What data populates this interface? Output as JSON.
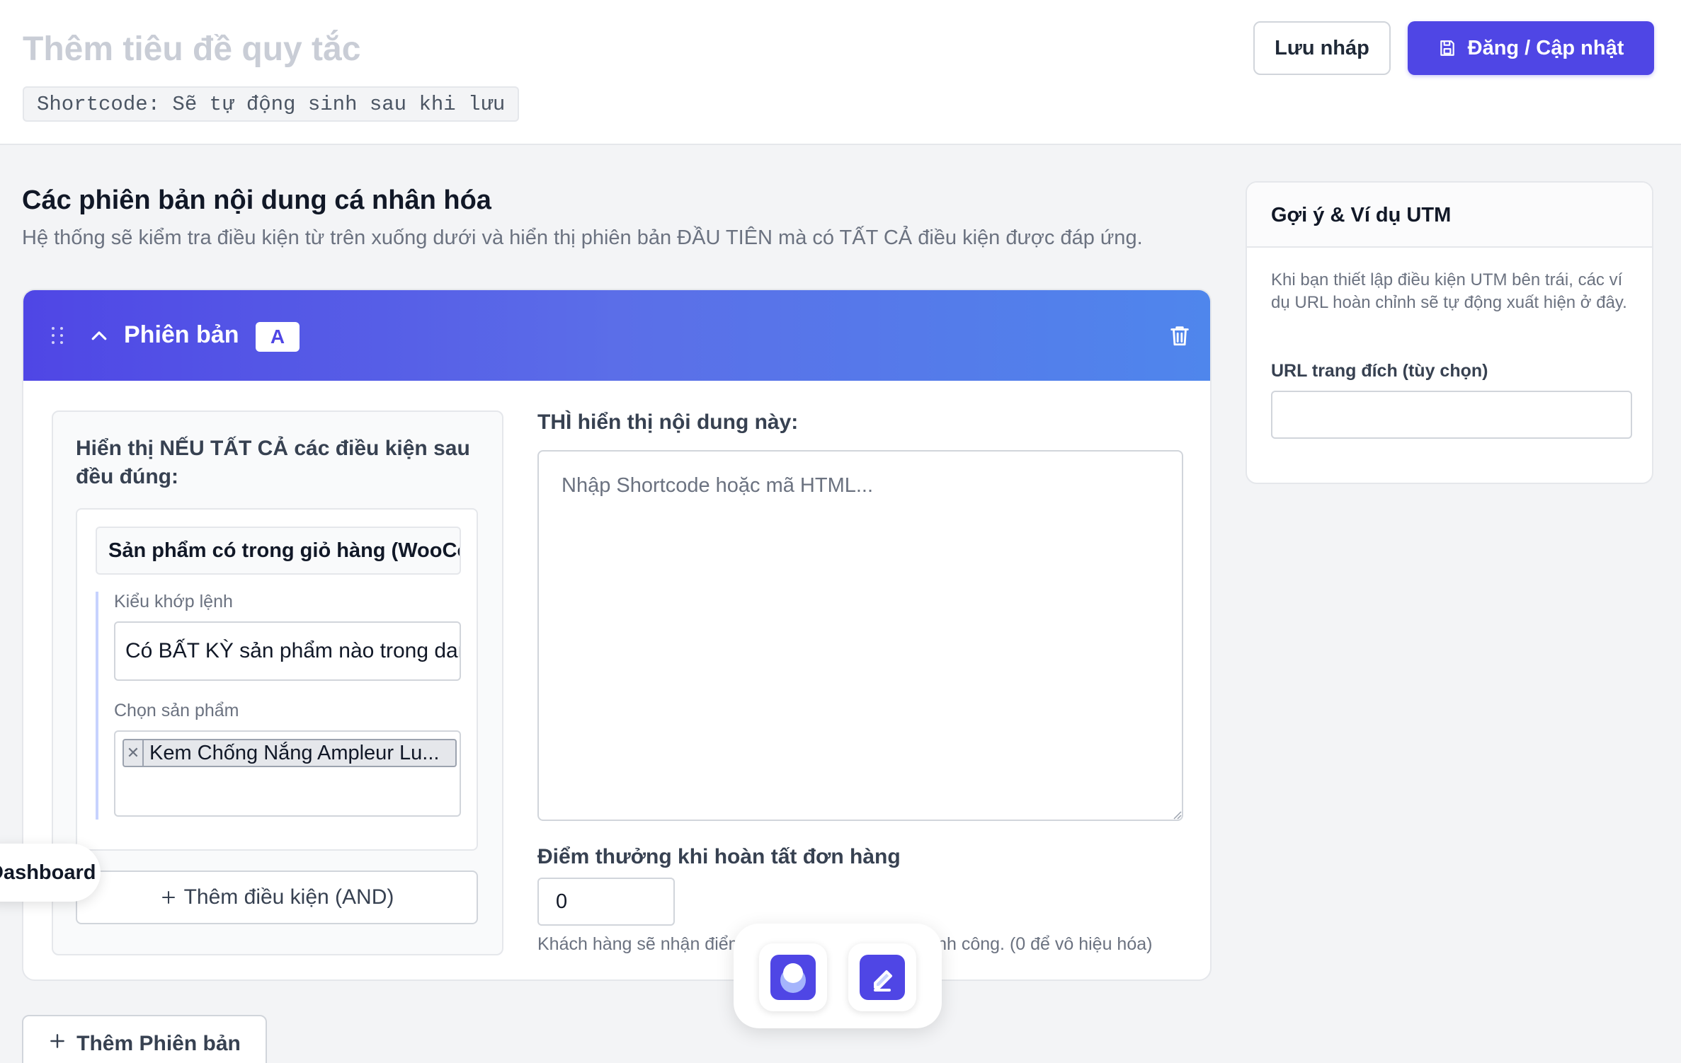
{
  "header": {
    "title_placeholder": "Thêm tiêu đề quy tắc",
    "shortcode_text": "Shortcode: Sẽ tự động sinh sau khi lưu",
    "save_draft_label": "Lưu nháp",
    "publish_label": "Đăng / Cập nhật"
  },
  "section": {
    "title": "Các phiên bản nội dung cá nhân hóa",
    "description": "Hệ thống sẽ kiểm tra điều kiện từ trên xuống dưới và hiển thị phiên bản ĐẦU TIÊN mà có TẤT CẢ điều kiện được đáp ứng."
  },
  "version": {
    "label": "Phiên bản",
    "badge": "A",
    "conditions": {
      "heading": "Hiển thị NẾU TẤT CẢ các điều kiện sau đều đúng:",
      "condition_type": "Sản phẩm có trong giỏ hàng (WooCommerce)",
      "match_label": "Kiểu khớp lệnh",
      "match_value": "Có BẤT KỲ sản phẩm nào trong danh sách",
      "product_label": "Chọn sản phẩm",
      "product_tag": "Kem Chống Nắng Ampleur Lu...",
      "add_condition_label": "Thêm điều kiện (AND)"
    },
    "content": {
      "label": "THÌ hiển thị nội dung này:",
      "placeholder": "Nhập Shortcode hoặc mã HTML...",
      "points_label": "Điểm thưởng khi hoàn tất đơn hàng",
      "points_value": "0",
      "points_help": "Khách hàng sẽ nhận điểm thưởng khi đặt hàng thành công. (0 để vô hiệu hóa)"
    }
  },
  "add_version_label": "Thêm Phiên bản",
  "utm": {
    "title": "Gợi ý & Ví dụ UTM",
    "description": "Khi bạn thiết lập điều kiện UTM bên trái, các ví dụ URL hoàn chỉnh sẽ tự động xuất hiện ở đây.",
    "url_label": "URL trang đích (tùy chọn)",
    "url_value": ""
  },
  "floating": {
    "dashboard_label": "Dashboard"
  },
  "colors": {
    "primary": "#4f46e5",
    "header_gradient_end": "#4f86ec"
  },
  "icons": {
    "publish": "save-icon",
    "drag": "drag-handle-icon",
    "collapse": "chevron-up-icon",
    "delete": "trash-icon",
    "add": "plus-icon",
    "remove_tag": "close-icon"
  }
}
